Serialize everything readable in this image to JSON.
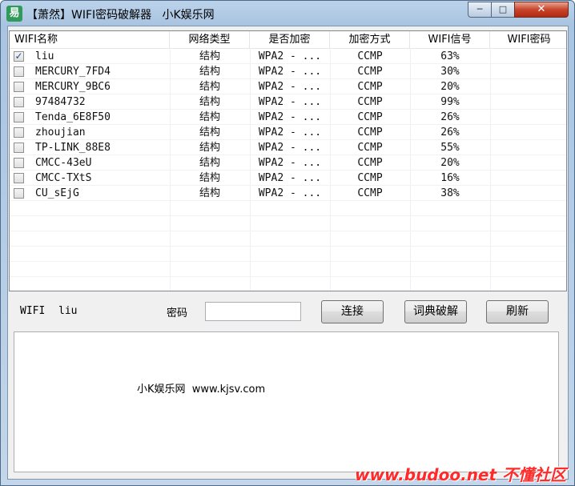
{
  "window": {
    "title": "【萧然】WIFI密码破解器   小K娱乐网",
    "min_label": "─",
    "max_label": "□",
    "close_label": "✕"
  },
  "list": {
    "columns": [
      "WIFI名称",
      "网络类型",
      "是否加密",
      "加密方式",
      "WIFI信号",
      "WIFI密码"
    ],
    "rows": [
      {
        "checked": true,
        "name": "liu",
        "type": "结构",
        "encrypted": "WPA2 - ...",
        "method": "CCMP",
        "signal": "63%",
        "password": ""
      },
      {
        "checked": false,
        "name": "MERCURY_7FD4",
        "type": "结构",
        "encrypted": "WPA2 - ...",
        "method": "CCMP",
        "signal": "30%",
        "password": ""
      },
      {
        "checked": false,
        "name": "MERCURY_9BC6",
        "type": "结构",
        "encrypted": "WPA2 - ...",
        "method": "CCMP",
        "signal": "20%",
        "password": ""
      },
      {
        "checked": false,
        "name": "97484732",
        "type": "结构",
        "encrypted": "WPA2 - ...",
        "method": "CCMP",
        "signal": "99%",
        "password": ""
      },
      {
        "checked": false,
        "name": "Tenda_6E8F50",
        "type": "结构",
        "encrypted": "WPA2 - ...",
        "method": "CCMP",
        "signal": "26%",
        "password": ""
      },
      {
        "checked": false,
        "name": "zhoujian",
        "type": "结构",
        "encrypted": "WPA2 - ...",
        "method": "CCMP",
        "signal": "26%",
        "password": ""
      },
      {
        "checked": false,
        "name": "TP-LINK_88E8",
        "type": "结构",
        "encrypted": "WPA2 - ...",
        "method": "CCMP",
        "signal": "55%",
        "password": ""
      },
      {
        "checked": false,
        "name": "CMCC-43eU",
        "type": "结构",
        "encrypted": "WPA2 - ...",
        "method": "CCMP",
        "signal": "20%",
        "password": ""
      },
      {
        "checked": false,
        "name": "CMCC-TXtS",
        "type": "结构",
        "encrypted": "WPA2 - ...",
        "method": "CCMP",
        "signal": "16%",
        "password": ""
      },
      {
        "checked": false,
        "name": "CU_sEjG",
        "type": "结构",
        "encrypted": "WPA2 - ...",
        "method": "CCMP",
        "signal": "38%",
        "password": ""
      }
    ]
  },
  "controls": {
    "wifi_label": "WIFI",
    "wifi_value": "liu",
    "password_label": "密码",
    "password_value": "",
    "connect_label": "连接",
    "dict_crack_label": "词典破解",
    "refresh_label": "刷新"
  },
  "log": {
    "text": "小K娱乐网  www.kjsv.com"
  },
  "watermark": "www.budoo.net 不懂社区"
}
